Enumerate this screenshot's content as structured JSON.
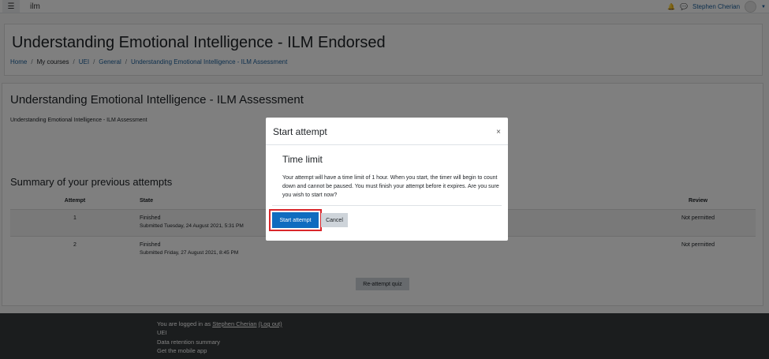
{
  "navbar": {
    "site_name": "ilm",
    "menu_icon": "hamburger-icon",
    "user_name": "Stephen Cherian"
  },
  "header": {
    "title": "Understanding Emotional Intelligence - ILM Endorsed",
    "breadcrumb": [
      "Home",
      "My courses",
      "UEI",
      "General",
      "Understanding Emotional Intelligence - ILM Assessment"
    ]
  },
  "quiz": {
    "title": "Understanding Emotional Intelligence - ILM Assessment",
    "intro": "Understanding Emotional Intelligence - ILM Assessment",
    "summary_heading": "Summary of your previous attempts",
    "columns": [
      "Attempt",
      "State",
      "Review"
    ],
    "rows": [
      {
        "attempt": "1",
        "state": "Finished",
        "submitted": "Submitted Tuesday, 24 August 2021, 5:31 PM",
        "review": "Not permitted"
      },
      {
        "attempt": "2",
        "state": "Finished",
        "submitted": "Submitted Friday, 27 August 2021, 8:45 PM",
        "review": "Not permitted"
      }
    ],
    "reattempt_label": "Re-attempt quiz"
  },
  "footer": {
    "logged_in_prefix": "You are logged in as ",
    "user_link": "Stephen Cherian",
    "logout_link": "(Log out)",
    "course_link": "UEI",
    "retention_link": "Data retention summary",
    "mobile_link": "Get the mobile app"
  },
  "modal": {
    "title": "Start attempt",
    "close": "×",
    "subtitle": "Time limit",
    "body": "Your attempt will have a time limit of 1 hour. When you start, the timer will begin to count down and cannot be paused. You must finish your attempt before it expires. Are you sure you wish to start now?",
    "start_label": "Start attempt",
    "cancel_label": "Cancel"
  },
  "colors": {
    "primary": "#0f6cbf",
    "highlight": "#d9262b",
    "link": "#1a5e9a",
    "footer": "#373a3c"
  }
}
